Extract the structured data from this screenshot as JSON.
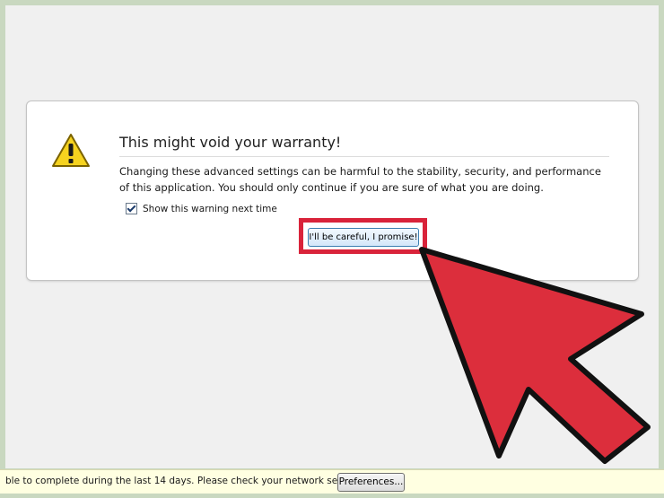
{
  "dialog": {
    "title": "This might void your warranty!",
    "description": "Changing these advanced settings can be harmful to the stability, security, and performance of this application. You should only continue if you are sure of what you are doing.",
    "checkbox": {
      "label": "Show this warning next time",
      "checked": true
    },
    "confirm_button": "I'll be careful, I promise!",
    "icon": "warning-icon"
  },
  "notification_bar": {
    "message": "ble to complete during the last 14 days. Please check your network settings.",
    "preferences_button": "Preferences..."
  },
  "overlay": {
    "arrow_icon": "pointer-arrow-icon",
    "highlight_color": "#d9233a",
    "arrow_color": "#dc2e3c"
  },
  "colors": {
    "frame": "#c9d8c0",
    "page_background": "#f0f0f0",
    "notification_background": "#ffffe1",
    "warning_yellow": "#f6d31f"
  }
}
